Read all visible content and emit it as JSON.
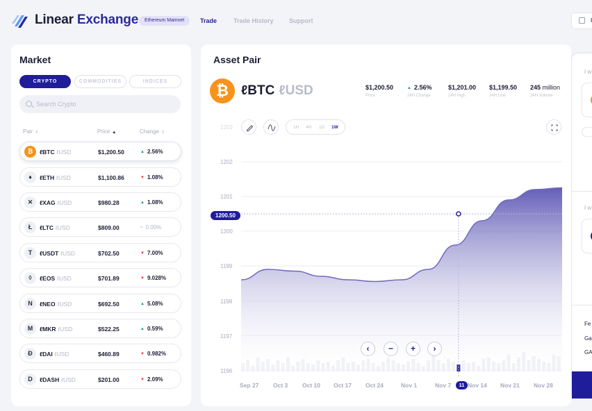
{
  "header": {
    "brand_part1": "Linear",
    "brand_part2": "Exchange",
    "network_badge": "Ethereum Mainnet",
    "nav": [
      {
        "label": "Trade"
      },
      {
        "label": "Trade History"
      },
      {
        "label": "Support"
      }
    ],
    "right_button_label": "F"
  },
  "market": {
    "title": "Market",
    "tabs": [
      {
        "label": "CRYPTO"
      },
      {
        "label": "COMMODITIES"
      },
      {
        "label": "INDICES"
      }
    ],
    "search_placeholder": "Search Crypto",
    "columns": {
      "pair": "Pair",
      "price": "Price",
      "change": "Change"
    },
    "rows": [
      {
        "base": "ℓBTC",
        "quote": "ℓUSD",
        "price": "$1,200.50",
        "change": "2.56%",
        "dir": "up",
        "icon": "₿"
      },
      {
        "base": "ℓETH",
        "quote": "ℓUSD",
        "price": "$1,100.86",
        "change": "1.08%",
        "dir": "down",
        "icon": "♦"
      },
      {
        "base": "ℓXAG",
        "quote": "ℓUSD",
        "price": "$980.28",
        "change": "1.08%",
        "dir": "up",
        "icon": "✕"
      },
      {
        "base": "ℓLTC",
        "quote": "ℓUSD",
        "price": "$809.00",
        "change": "0.00%",
        "dir": "flat",
        "icon": "Ł"
      },
      {
        "base": "ℓUSDT",
        "quote": "ℓUSD",
        "price": "$702.50",
        "change": "7.00%",
        "dir": "down",
        "icon": "T"
      },
      {
        "base": "ℓEOS",
        "quote": "ℓUSD",
        "price": "$701.89",
        "change": "9.028%",
        "dir": "down",
        "icon": "◊"
      },
      {
        "base": "ℓNEO",
        "quote": "ℓUSD",
        "price": "$692.50",
        "change": "5.08%",
        "dir": "up",
        "icon": "N"
      },
      {
        "base": "ℓMKR",
        "quote": "ℓUSD",
        "price": "$522.25",
        "change": "0.59%",
        "dir": "up",
        "icon": "M"
      },
      {
        "base": "ℓDAI",
        "quote": "ℓUSD",
        "price": "$460.89",
        "change": "0.982%",
        "dir": "down",
        "icon": "Ð"
      },
      {
        "base": "ℓDASH",
        "quote": "ℓUSD",
        "price": "$201.00",
        "change": "2.09%",
        "dir": "down",
        "icon": "D"
      }
    ]
  },
  "asset": {
    "title": "Asset Pair",
    "base": "ℓBTC",
    "quote": "ℓUSD",
    "stats": [
      {
        "value": "$1,200.50",
        "label": "Price"
      },
      {
        "value": "2.56%",
        "label": "24H Change"
      },
      {
        "value": "$1,201.00",
        "label": "24H High"
      },
      {
        "value": "$1,199.50",
        "label": "24H Low"
      },
      {
        "value": "245",
        "unit": "million",
        "label": "24H Volume"
      }
    ],
    "timeframes": [
      "1H",
      "4H",
      "1D",
      "1W"
    ],
    "active_timeframe": "1W",
    "current_price_tag": "1200.50",
    "selected_date_tag": "11",
    "colors": {
      "accent": "#1f1d9a",
      "area": "#6f69be",
      "up": "#1a9b6c",
      "down": "#e53935"
    }
  },
  "chart_data": {
    "type": "area",
    "y_ticks": [
      "1203",
      "1202",
      "1201",
      "1200",
      "1199",
      "1198",
      "1197",
      "1196"
    ],
    "ylim": [
      1196,
      1203
    ],
    "x_ticks": [
      "Sep 27",
      "Oct 3",
      "Oct 10",
      "Oct 17",
      "Oct 24",
      "Nov 1",
      "Nov 7",
      "Nov 14",
      "Nov 21",
      "Nov 28"
    ],
    "series": [
      {
        "values": [
          1198.6,
          1198.9,
          1198.85,
          1198.7,
          1198.6,
          1198.55,
          1198.6,
          1198.9,
          1199.6,
          1200.3,
          1200.9,
          1201.2,
          1201.25
        ]
      }
    ],
    "volume_levels": [
      0.3,
      0.4,
      0.2,
      0.5,
      0.35,
      0.45,
      0.25,
      0.4,
      0.3,
      0.5,
      0.2,
      0.35,
      0.45,
      0.3,
      0.25,
      0.4,
      0.3,
      0.35,
      0.2,
      0.4,
      0.5,
      0.3,
      0.35,
      0.25,
      0.4,
      0.45,
      0.3,
      0.2,
      0.35,
      0.5,
      0.4,
      0.3,
      0.25,
      0.35,
      0.45,
      0.3,
      0.2,
      0.4,
      0.6,
      0.4,
      0.3,
      0.45,
      0.35,
      0.25,
      0.4,
      0.3,
      0.35,
      0.2,
      0.45,
      0.5,
      0.35,
      0.3,
      0.4,
      0.6,
      0.3,
      0.5,
      0.7,
      0.4,
      0.55,
      0.45,
      0.35,
      0.3,
      0.6,
      0.55
    ],
    "highlight_index": 43,
    "marker_value": 1200.5
  }
}
